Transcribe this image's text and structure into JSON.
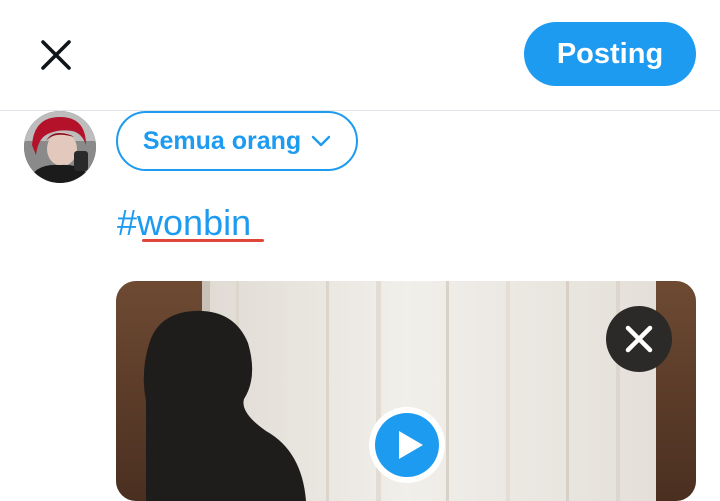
{
  "header": {
    "close_icon": "close-icon",
    "post_label": "Posting"
  },
  "composer": {
    "avatar_icon": "avatar",
    "audience_label": "Semua orang",
    "audience_icon": "chevron-down-icon",
    "text": "#wonbin"
  },
  "media": {
    "remove_icon": "close-icon",
    "play_icon": "play-icon"
  },
  "colors": {
    "accent": "#1d9bf0",
    "spellcheck": "#e0453a",
    "remove_bg": "#2b2a29"
  }
}
